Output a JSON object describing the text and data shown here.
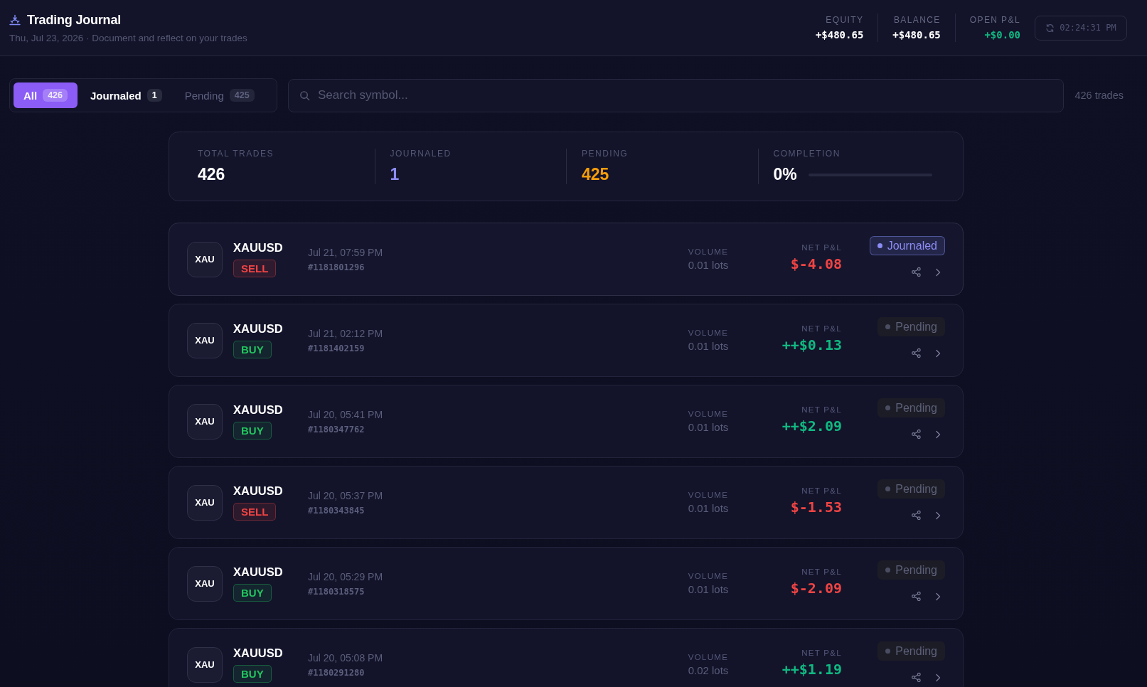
{
  "header": {
    "title": "Trading Journal",
    "subtitle": "Thu, Jul 23, 2026 · Document and reflect on your trades",
    "metrics": [
      {
        "label": "EQUITY",
        "value": "+$480.65",
        "color": "#ffffff"
      },
      {
        "label": "BALANCE",
        "value": "+$480.65",
        "color": "#ffffff"
      },
      {
        "label": "OPEN P&L",
        "value": "+$0.00",
        "color": "#10b981"
      }
    ],
    "clock": "02:24:31 PM"
  },
  "filters": {
    "tabs": [
      {
        "label": "All",
        "count": "426",
        "selected": true,
        "hovered": false
      },
      {
        "label": "Journaled",
        "count": "1",
        "selected": false,
        "hovered": true
      },
      {
        "label": "Pending",
        "count": "425",
        "selected": false,
        "hovered": false
      }
    ],
    "search": {
      "placeholder": "Search symbol..."
    },
    "result_count": "426 trades"
  },
  "summary": [
    {
      "kind": "count",
      "label": "TOTAL TRADES",
      "value": "426",
      "color": "#ffffff"
    },
    {
      "kind": "count",
      "label": "JOURNALED",
      "value": "1",
      "color": "#8b8cf5"
    },
    {
      "kind": "count",
      "label": "PENDING",
      "value": "425",
      "color": "#f59e0b"
    },
    {
      "kind": "progress",
      "label": "COMPLETION",
      "value": "0%",
      "color": "#ffffff",
      "level": 0
    }
  ],
  "trades": [
    {
      "avatar": "XAU",
      "symbol": "XAUUSD",
      "side": {
        "label": "SELL",
        "kind": "sell"
      },
      "time": "Jul 21, 07:59 PM",
      "ticket": "#1181801296",
      "volume_label": "VOLUME",
      "volume": "0.01 lots",
      "pnl_label": "NET P&L",
      "pnl": {
        "text": "$-4.08",
        "kind": "loss"
      },
      "status": {
        "label": "Journaled",
        "kind": "journaled"
      }
    },
    {
      "avatar": "XAU",
      "symbol": "XAUUSD",
      "side": {
        "label": "BUY",
        "kind": "buy"
      },
      "time": "Jul 21, 02:12 PM",
      "ticket": "#1181402159",
      "volume_label": "VOLUME",
      "volume": "0.01 lots",
      "pnl_label": "NET P&L",
      "pnl": {
        "text": "++$0.13",
        "kind": "gain"
      },
      "status": {
        "label": "Pending",
        "kind": "pending"
      }
    },
    {
      "avatar": "XAU",
      "symbol": "XAUUSD",
      "side": {
        "label": "BUY",
        "kind": "buy"
      },
      "time": "Jul 20, 05:41 PM",
      "ticket": "#1180347762",
      "volume_label": "VOLUME",
      "volume": "0.01 lots",
      "pnl_label": "NET P&L",
      "pnl": {
        "text": "++$2.09",
        "kind": "gain"
      },
      "status": {
        "label": "Pending",
        "kind": "pending"
      }
    },
    {
      "avatar": "XAU",
      "symbol": "XAUUSD",
      "side": {
        "label": "SELL",
        "kind": "sell"
      },
      "time": "Jul 20, 05:37 PM",
      "ticket": "#1180343845",
      "volume_label": "VOLUME",
      "volume": "0.01 lots",
      "pnl_label": "NET P&L",
      "pnl": {
        "text": "$-1.53",
        "kind": "loss"
      },
      "status": {
        "label": "Pending",
        "kind": "pending"
      }
    },
    {
      "avatar": "XAU",
      "symbol": "XAUUSD",
      "side": {
        "label": "BUY",
        "kind": "buy"
      },
      "time": "Jul 20, 05:29 PM",
      "ticket": "#1180318575",
      "volume_label": "VOLUME",
      "volume": "0.01 lots",
      "pnl_label": "NET P&L",
      "pnl": {
        "text": "$-2.09",
        "kind": "loss"
      },
      "status": {
        "label": "Pending",
        "kind": "pending"
      }
    },
    {
      "avatar": "XAU",
      "symbol": "XAUUSD",
      "side": {
        "label": "BUY",
        "kind": "buy"
      },
      "time": "Jul 20, 05:08 PM",
      "ticket": "#1180291280",
      "volume_label": "VOLUME",
      "volume": "0.02 lots",
      "pnl_label": "NET P&L",
      "pnl": {
        "text": "++$1.19",
        "kind": "gain"
      },
      "status": {
        "label": "Pending",
        "kind": "pending"
      }
    }
  ]
}
